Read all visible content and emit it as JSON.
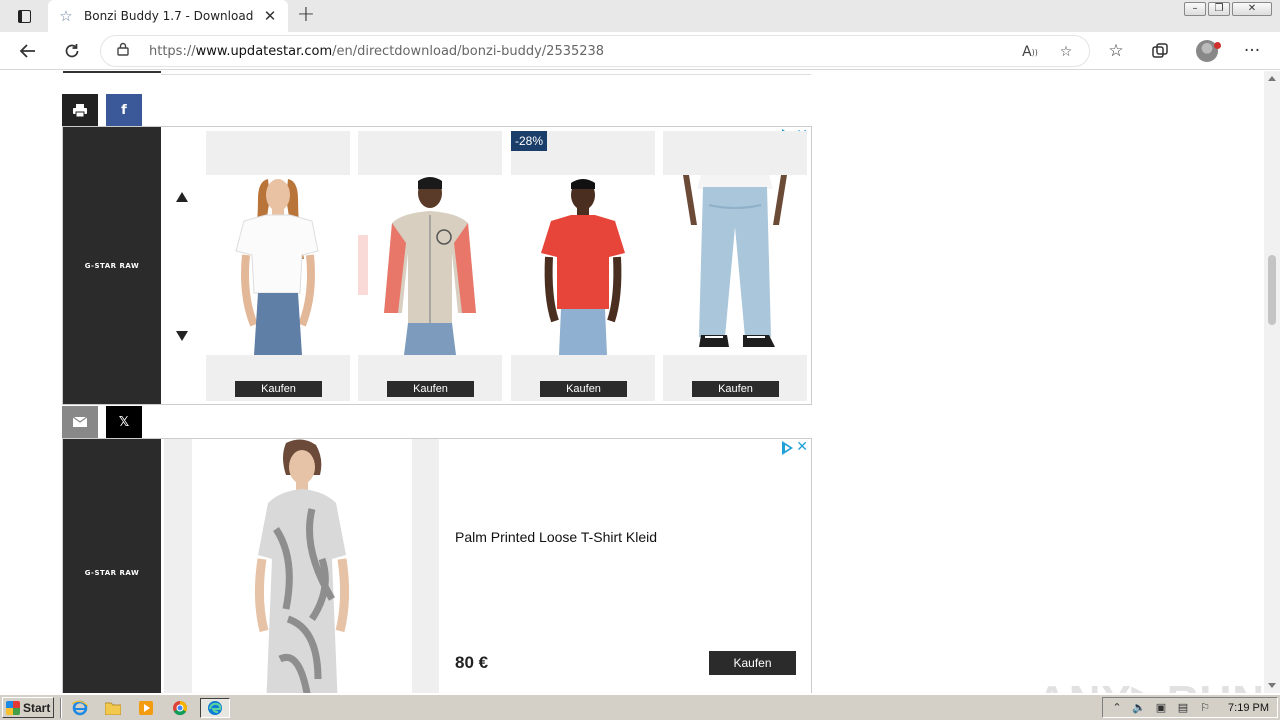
{
  "browser": {
    "tab_title": "Bonzi Buddy 1.7 - Download",
    "url_scheme": "https://",
    "url_host": "www.updatestar.com",
    "url_path": "/en/directdownload/bonzi-buddy/2535238",
    "new_tab_symbol": "+",
    "tab_close_symbol": "✕"
  },
  "share": {
    "facebook_label": "f",
    "x_label": "𝕏"
  },
  "ad1": {
    "brand": "G-STAR RAW",
    "products": [
      {
        "badge": "",
        "button": "Kaufen"
      },
      {
        "badge": "",
        "button": "Kaufen"
      },
      {
        "badge": "-28%",
        "button": "Kaufen"
      },
      {
        "badge": "",
        "button": "Kaufen"
      }
    ]
  },
  "ad2": {
    "brand": "G-STAR RAW",
    "title": "Palm Printed Loose T-Shirt Kleid",
    "price": "80 €",
    "button": "Kaufen"
  },
  "watermark": "ANY▷RUN",
  "taskbar": {
    "start_label": "Start",
    "clock": "7:19 PM"
  },
  "colors": {
    "accent_blue": "#21a0d6",
    "facebook": "#3b5998",
    "badge": "#1b3d69",
    "ad_dark": "#2b2b2b"
  }
}
